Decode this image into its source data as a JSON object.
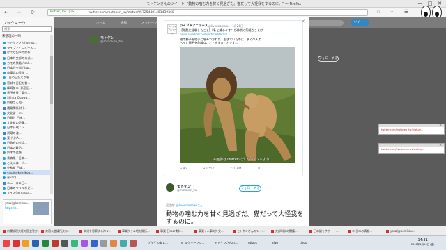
{
  "window": {
    "title": "モトケンさんのツイート: \"動物の噛む力を甘く見過ぎだ。猫だって大怪我をするのに。\" — Firefox",
    "controls": [
      "—",
      "□",
      "✕"
    ]
  },
  "addressbar": {
    "secure_label": "Twitter, Inc. [US]",
    "url": "twitter.com/motoken_tw/status/957254401451439360",
    "nav": [
      "←",
      "→",
      "⟳"
    ],
    "right_icons": [
      "☆",
      "⋯",
      "☰"
    ]
  },
  "sidebar": {
    "title": "ブックマーク",
    "search_placeholder": "検索",
    "folder": "未整理の一時",
    "items": [
      {
        "label": "モトケンさん(@mot...",
        "icon": "twitter-icon"
      },
      {
        "label": "ライブアイニュース...",
        "icon": "twitter-icon"
      },
      {
        "label": "はてな記事の保存...",
        "icon": "bookmark-icon"
      },
      {
        "label": "日本外交部の公式...",
        "icon": "twitter-icon"
      },
      {
        "label": "カモの巣箱 / sak...",
        "icon": "twitter-icon"
      },
      {
        "label": "日本外交部 / Jap...",
        "icon": "twitter-icon"
      },
      {
        "label": "南東北の見学 ...",
        "icon": "twitter-icon"
      },
      {
        "label": "1日の日記とかを...",
        "icon": "twitter-icon"
      },
      {
        "label": "宮城で日記を書...",
        "icon": "twitter-icon"
      },
      {
        "label": "峰崎新二 (新宿区...",
        "icon": "twitter-icon"
      },
      {
        "label": "豊田市長 / 東京...",
        "icon": "twitter-icon"
      },
      {
        "label": "Shinta Oguwa...",
        "icon": "twitter-icon"
      },
      {
        "label": "川越さん(@...",
        "icon": "twitter-icon"
      },
      {
        "label": "農業関係(市)...",
        "icon": "bookmark-icon"
      },
      {
        "label": "文化省 / 市...",
        "icon": "twitter-icon"
      },
      {
        "label": "日銀と 日米...",
        "icon": "twitter-icon"
      },
      {
        "label": "文化省の記事...",
        "icon": "twitter-icon"
      },
      {
        "label": "日本行政 / G...",
        "icon": "twitter-icon"
      },
      {
        "label": "武蔵の道...",
        "icon": "bookmark-icon"
      },
      {
        "label": "東 光(nA...",
        "icon": "twitter-icon"
      },
      {
        "label": "日政府の会話...",
        "icon": "twitter-icon"
      },
      {
        "label": "日本の政治...",
        "icon": "twitter-icon"
      },
      {
        "label": "鈴木の会議...",
        "icon": "twitter-icon"
      },
      {
        "label": "青森県 / 日本...",
        "icon": "twitter-icon"
      },
      {
        "label": "こえんは一人...",
        "icon": "twitter-icon"
      },
      {
        "label": "外務省 日本...",
        "icon": "twitter-icon"
      },
      {
        "label": "yasa(@kemikou...",
        "icon": "twitter-icon"
      },
      {
        "label": "@kan(...)",
        "icon": "twitter-icon"
      },
      {
        "label": "ニュースの日...",
        "icon": "bookmark-icon"
      },
      {
        "label": "日本のウラルなど...",
        "icon": "twitter-icon"
      },
      {
        "label": "マイス(@massa...",
        "icon": "twitter-icon"
      }
    ],
    "preview_title": "yasa(@kemikou...",
    "preview_sub": "https://t..."
  },
  "background_page": {
    "tabs": [
      "ホーム",
      "通知",
      "メッセージ"
    ],
    "profile_name": "モトケン",
    "profile_handle": "@motoken_tw",
    "follow_label": "フォローする",
    "tweet_label": "ツイート"
  },
  "quoted_tweet": {
    "source_logo": "ライブドアニュース",
    "name": "ライブドアニュース",
    "handle": "@livedoornews · 1月26日",
    "line1": "【残酷に経験したこと】「私と雌ライオンが仲良く気軽なことは...",
    "line2": "news.livedoor.com/article/detail/...",
    "line3": "雄の獅子を相手に噛みつかれた...生きていたのに...多くの人の...",
    "line4": "ヘラと獅子を危険なことと考えることです...",
    "photo_credit": "※画像はTwitter公式アカウントより",
    "actions": [
      "↩ 96",
      "⇄ 1,552",
      "♡ 1,344",
      "✉"
    ]
  },
  "retweet": {
    "name": "モトケン",
    "handle": "@motoken_tw",
    "follow_label": "フォローする",
    "reply_prefix": "返信先:",
    "reply_to": "@livedoornewsさん",
    "body_line1": "動物の噛む力を甘く見過ぎだ。猫だって大怪我を",
    "body_line2": "するのに。"
  },
  "popups": [
    {
      "link": "twitter.com/motoken_tw/status/..."
    },
    {
      "link": "twitter.com/livedoornews/status/..."
    }
  ],
  "statusbar_tabs": [
    "内閣総理大臣の国会答弁...",
    "来宿公会議所文の...",
    "文化を思索する神々...",
    "事業ウラル地を開拓...",
    "事業 日本の食料...",
    "事業 / 人事の外交...",
    "モトケンさんのツイ...",
    "文部科学の閣議...",
    "日本語をサポート...",
    "ホ 日本の情報...",
    "yasa(@kemikou..."
  ],
  "taskbar": {
    "items": [
      "ゲゲゲの鬼太...",
      "e_スクリーンシ...",
      "モトケンさんの...",
      "ntlook",
      "aigo",
      "tlogo"
    ],
    "clock_time": "14:31",
    "clock_date": "2018年1月26日 (金)"
  },
  "colors": {
    "twitter_blue": "#1da1f2",
    "link_blue": "#1b95e0",
    "overlay": "#5b5b5b"
  }
}
